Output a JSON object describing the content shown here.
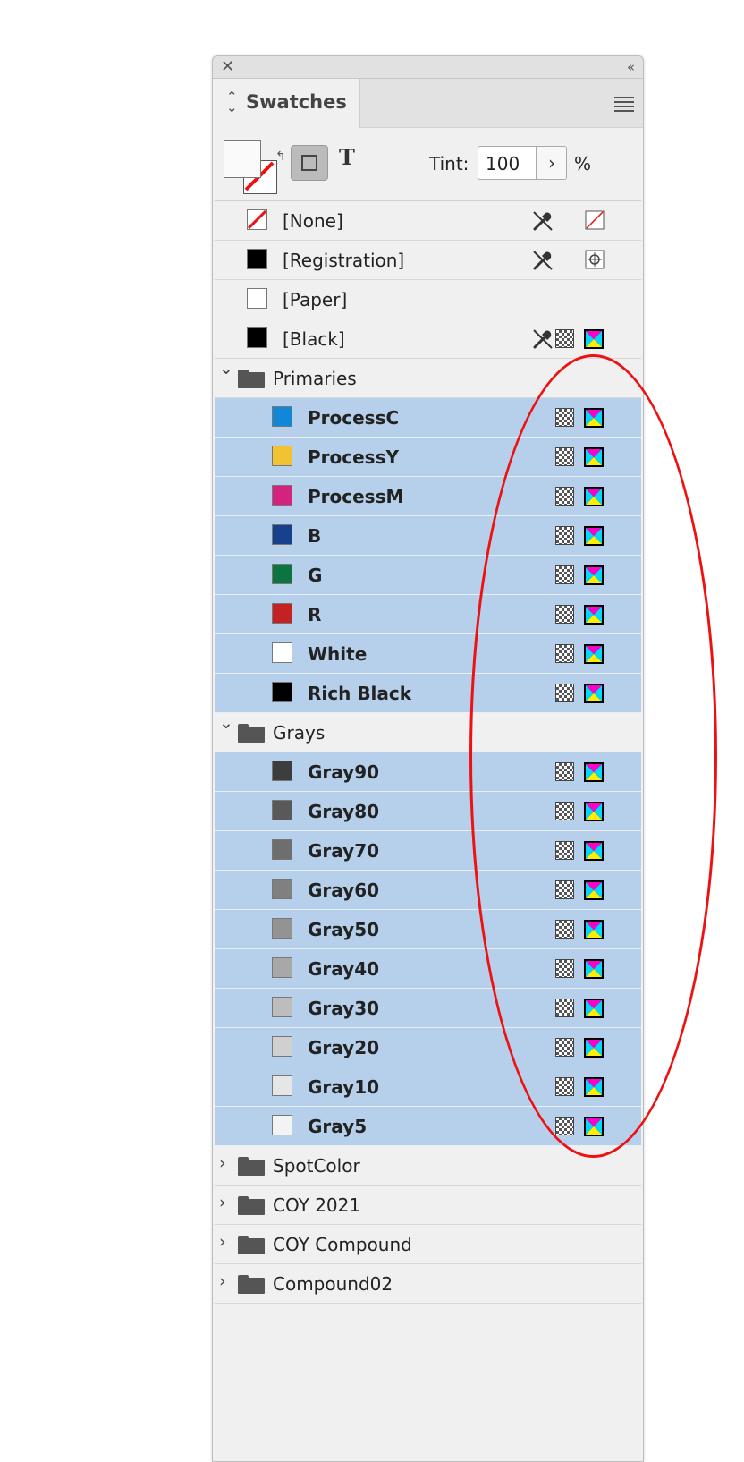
{
  "panel": {
    "title": "Swatches",
    "tint_label": "Tint:",
    "tint_value": "100",
    "tint_unit": "%",
    "text_format_glyph": "T"
  },
  "colors": {
    "selection_bg": "#b6cfea",
    "panel_bg": "#f0f0f0",
    "annotation_red": "#e11111"
  },
  "items": [
    {
      "type": "swatch",
      "level": 1,
      "name": "[None]",
      "chip": "none",
      "icons": [
        "pen",
        "none-mode"
      ]
    },
    {
      "type": "swatch",
      "level": 1,
      "name": "[Registration]",
      "chip": "#000000",
      "icons": [
        "pen",
        "registration-mode"
      ]
    },
    {
      "type": "swatch",
      "level": 1,
      "name": "[Paper]",
      "chip": "#ffffff",
      "icons": []
    },
    {
      "type": "swatch",
      "level": 1,
      "name": "[Black]",
      "chip": "#000000",
      "icons": [
        "pen",
        "process",
        "cmyk"
      ]
    },
    {
      "type": "group",
      "name": "Primaries",
      "expanded": true
    },
    {
      "type": "swatch",
      "level": 2,
      "selected": true,
      "name": "ProcessC",
      "chip": "#1287d8",
      "icons": [
        "process",
        "cmyk"
      ]
    },
    {
      "type": "swatch",
      "level": 2,
      "selected": true,
      "name": "ProcessY",
      "chip": "#f1c232",
      "icons": [
        "process",
        "cmyk"
      ]
    },
    {
      "type": "swatch",
      "level": 2,
      "selected": true,
      "name": "ProcessM",
      "chip": "#d4237f",
      "icons": [
        "process",
        "cmyk"
      ]
    },
    {
      "type": "swatch",
      "level": 2,
      "selected": true,
      "name": "B",
      "chip": "#17418c",
      "icons": [
        "process",
        "cmyk"
      ]
    },
    {
      "type": "swatch",
      "level": 2,
      "selected": true,
      "name": "G",
      "chip": "#0b7440",
      "icons": [
        "process",
        "cmyk"
      ]
    },
    {
      "type": "swatch",
      "level": 2,
      "selected": true,
      "name": "R",
      "chip": "#c42222",
      "icons": [
        "process",
        "cmyk"
      ]
    },
    {
      "type": "swatch",
      "level": 2,
      "selected": true,
      "name": "White",
      "chip": "#ffffff",
      "icons": [
        "process",
        "cmyk"
      ]
    },
    {
      "type": "swatch",
      "level": 2,
      "selected": true,
      "name": "Rich Black",
      "chip": "#000000",
      "icons": [
        "process",
        "cmyk"
      ]
    },
    {
      "type": "group",
      "name": "Grays",
      "expanded": true
    },
    {
      "type": "swatch",
      "level": 2,
      "selected": true,
      "name": "Gray90",
      "chip": "#3d3d3d",
      "icons": [
        "process",
        "cmyk"
      ]
    },
    {
      "type": "swatch",
      "level": 2,
      "selected": true,
      "name": "Gray80",
      "chip": "#595959",
      "icons": [
        "process",
        "cmyk"
      ]
    },
    {
      "type": "swatch",
      "level": 2,
      "selected": true,
      "name": "Gray70",
      "chip": "#6e6e6e",
      "icons": [
        "process",
        "cmyk"
      ]
    },
    {
      "type": "swatch",
      "level": 2,
      "selected": true,
      "name": "Gray60",
      "chip": "#808080",
      "icons": [
        "process",
        "cmyk"
      ]
    },
    {
      "type": "swatch",
      "level": 2,
      "selected": true,
      "name": "Gray50",
      "chip": "#939393",
      "icons": [
        "process",
        "cmyk"
      ]
    },
    {
      "type": "swatch",
      "level": 2,
      "selected": true,
      "name": "Gray40",
      "chip": "#a8a8a8",
      "icons": [
        "process",
        "cmyk"
      ]
    },
    {
      "type": "swatch",
      "level": 2,
      "selected": true,
      "name": "Gray30",
      "chip": "#bdbdbd",
      "icons": [
        "process",
        "cmyk"
      ]
    },
    {
      "type": "swatch",
      "level": 2,
      "selected": true,
      "name": "Gray20",
      "chip": "#d0d0d0",
      "icons": [
        "process",
        "cmyk"
      ]
    },
    {
      "type": "swatch",
      "level": 2,
      "selected": true,
      "name": "Gray10",
      "chip": "#e6e6e6",
      "icons": [
        "process",
        "cmyk"
      ]
    },
    {
      "type": "swatch",
      "level": 2,
      "selected": true,
      "name": "Gray5",
      "chip": "#f3f3f3",
      "icons": [
        "process",
        "cmyk"
      ]
    },
    {
      "type": "group",
      "name": "SpotColor",
      "expanded": false
    },
    {
      "type": "group",
      "name": "COY 2021",
      "expanded": false
    },
    {
      "type": "group",
      "name": "COY Compound",
      "expanded": false
    },
    {
      "type": "group",
      "name": "Compound02",
      "expanded": false
    }
  ]
}
